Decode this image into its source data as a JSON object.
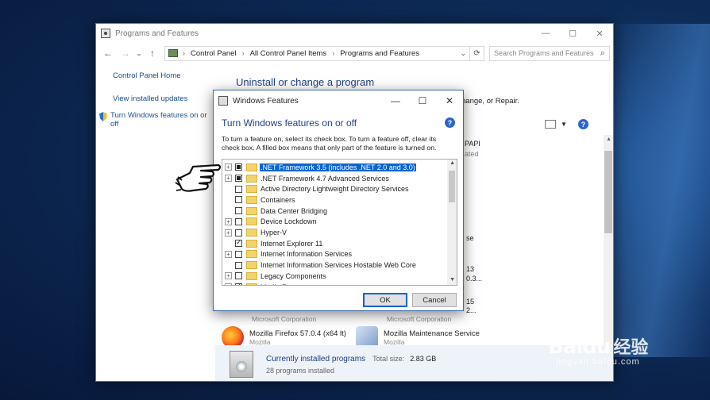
{
  "pf_window": {
    "title": "Programs and Features",
    "controls": {
      "minimize": "—",
      "maximize": "☐",
      "close": "✕"
    },
    "nav": {
      "back": "←",
      "forward": "→",
      "recent": "⌄",
      "up": "↑"
    },
    "breadcrumb": [
      "Control Panel",
      "All Control Panel Items",
      "Programs and Features"
    ],
    "address_dropdown": "⌄",
    "refresh": "⟳",
    "search_placeholder": "Search Programs and Features",
    "sidebar": {
      "home": "Control Panel Home",
      "updates": "View installed updates",
      "features": "Turn Windows features on or off"
    },
    "heading": "Uninstall or change a program",
    "change_text": "hange, or Repair.",
    "fragments": {
      "papi": "PAPI",
      "ated": "ated",
      "se": "se",
      "n13": "13",
      "v03": "0.3...",
      "n15": "15",
      "n2": "2..."
    },
    "publishers": [
      "Microsoft Corporation",
      "Microsoft Corporation"
    ],
    "programs": [
      {
        "name": "Mozilla Firefox 57.0.4 (x64 lt)",
        "publisher": "Mozilla",
        "icon": "firefox-icon"
      },
      {
        "name": "Mozilla Maintenance Service",
        "publisher": "Mozilla",
        "icon": "mozilla-maintenance-icon"
      }
    ],
    "footer": {
      "title": "Currently installed programs",
      "total_label": "Total size:",
      "total_value": "2.83 GB",
      "count": "28 programs installed"
    }
  },
  "wf_dialog": {
    "title": "Windows Features",
    "controls": {
      "minimize": "—",
      "maximize": "☐",
      "close": "✕"
    },
    "heading": "Turn Windows features on or off",
    "help": "?",
    "instructions": "To turn a feature on, select its check box. To turn a feature off, clear its check box. A filled box means that only part of the feature is turned on.",
    "features": [
      {
        "label": ".NET Framework 3.5 (includes .NET 2.0 and 3.0)",
        "state": "partial",
        "expandable": true,
        "selected": true
      },
      {
        "label": ".NET Framework 4.7 Advanced Services",
        "state": "partial",
        "expandable": true,
        "selected": false
      },
      {
        "label": "Active Directory Lightweight Directory Services",
        "state": "unchecked",
        "expandable": false,
        "selected": false
      },
      {
        "label": "Containers",
        "state": "unchecked",
        "expandable": false,
        "selected": false
      },
      {
        "label": "Data Center Bridging",
        "state": "unchecked",
        "expandable": false,
        "selected": false
      },
      {
        "label": "Device Lockdown",
        "state": "unchecked",
        "expandable": true,
        "selected": false
      },
      {
        "label": "Hyper-V",
        "state": "unchecked",
        "expandable": true,
        "selected": false
      },
      {
        "label": "Internet Explorer 11",
        "state": "checked",
        "expandable": false,
        "selected": false
      },
      {
        "label": "Internet Information Services",
        "state": "unchecked",
        "expandable": true,
        "selected": false
      },
      {
        "label": "Internet Information Services Hostable Web Core",
        "state": "unchecked",
        "expandable": false,
        "selected": false
      },
      {
        "label": "Legacy Components",
        "state": "unchecked",
        "expandable": true,
        "selected": false
      },
      {
        "label": "Media Features",
        "state": "checked",
        "expandable": true,
        "selected": false
      }
    ],
    "ok_label": "OK",
    "cancel_label": "Cancel"
  },
  "watermark": {
    "logo": "Baidu",
    "cn": "经验",
    "url": "jingyan.baidu.com"
  },
  "colors": {
    "accent": "#0a64d4",
    "heading": "#1e3e8a",
    "link": "#1b4f8f"
  }
}
